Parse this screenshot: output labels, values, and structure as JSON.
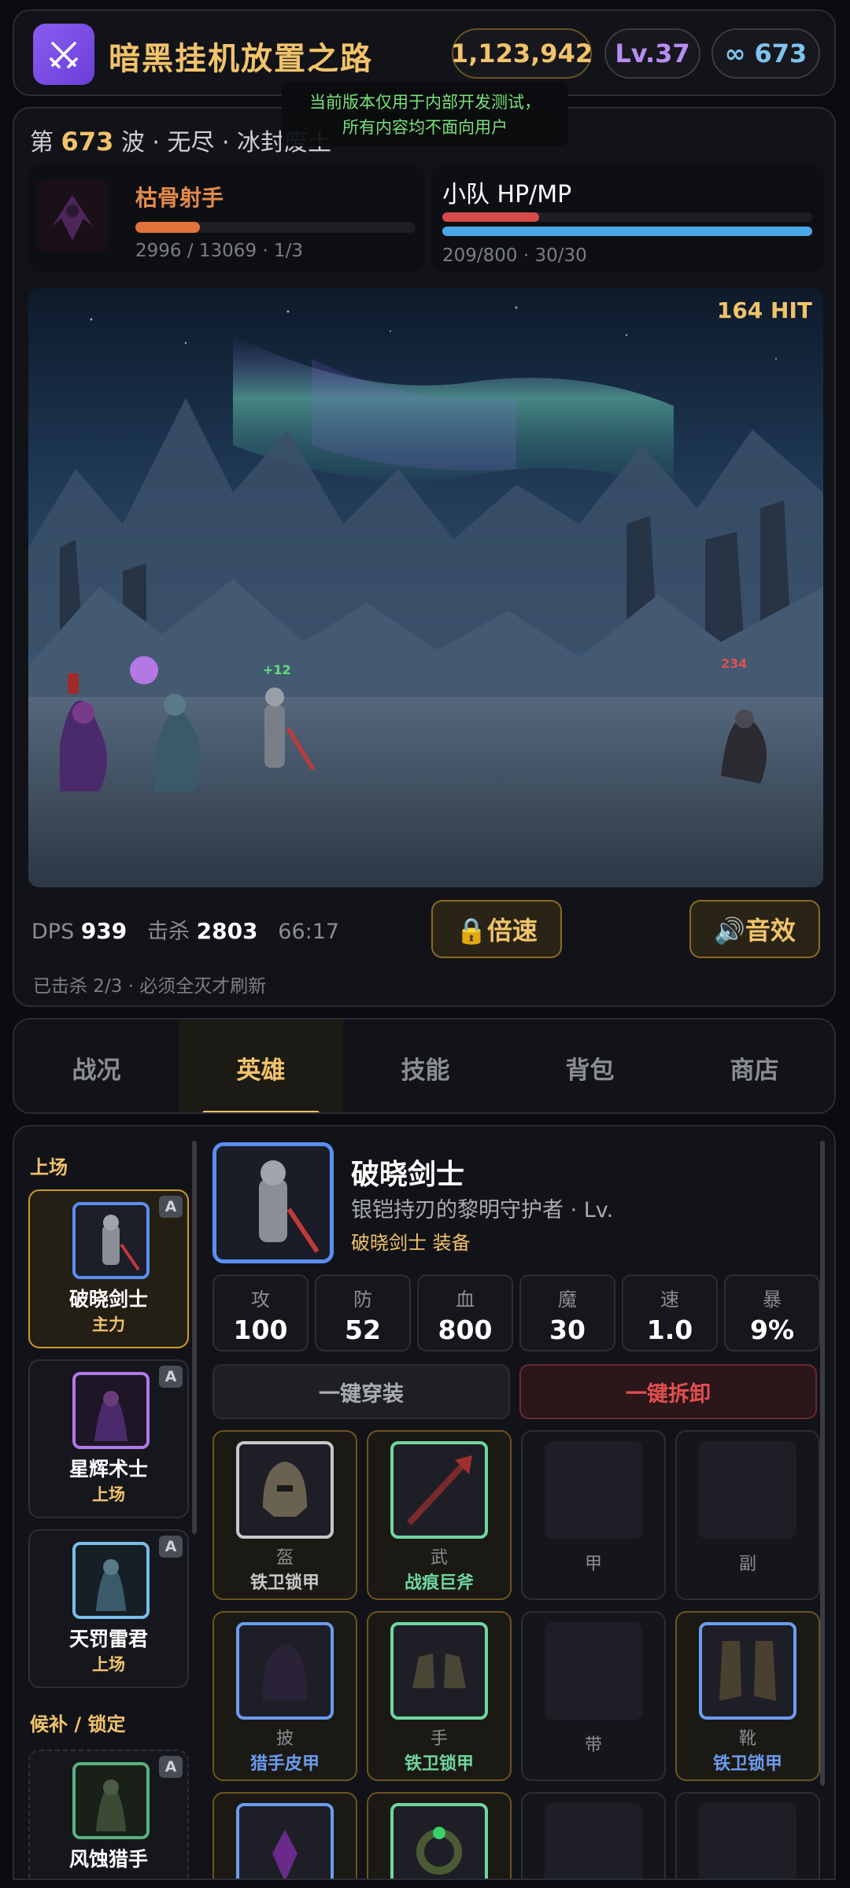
{
  "app": {
    "title": "暗黑挂机放置之路",
    "gold": "1,123,942",
    "level": "Lv.37",
    "infinite": "∞ 673"
  },
  "notice": {
    "line1": "当前版本仅用于内部开发测试，",
    "line2": "所有内容均不面向用户"
  },
  "wave": {
    "prefix": "第",
    "number": "673",
    "suffix": "波 · 无尽 · 冰封废土"
  },
  "enemy": {
    "name": "枯骨射手",
    "hp_text": "2996 / 13069 · 1/3",
    "hp_fraction": 0.229,
    "color": "#e0743a"
  },
  "party": {
    "title": "小队 HP/MP",
    "hp_fraction": 0.2613,
    "mp_fraction": 1.0,
    "text": "209/800 · 30/30",
    "hp_color": "#d64a4a",
    "mp_color": "#4aa8e8"
  },
  "scene": {
    "hit": "164 HIT",
    "heal_popup": "+12",
    "damage_popup": "234"
  },
  "stats": {
    "dps_label": "DPS",
    "dps": "939",
    "kills_label": "击杀",
    "kills": "2803",
    "time": "66:17",
    "speed_button": "🔒倍速",
    "sound_button": "🔊音效",
    "kill_info": "已击杀 2/3 · 必须全灭才刷新"
  },
  "tabs": [
    {
      "label": "战况"
    },
    {
      "label": "英雄"
    },
    {
      "label": "技能"
    },
    {
      "label": "背包"
    },
    {
      "label": "商店"
    }
  ],
  "roster": {
    "section_active": "上场",
    "section_bench": "候补 / 锁定",
    "badge": "A",
    "heroes": [
      {
        "name": "破晓剑士",
        "role": "主力"
      },
      {
        "name": "星辉术士",
        "role": "上场"
      },
      {
        "name": "天罚雷君",
        "role": "上场"
      },
      {
        "name": "风蚀猎手",
        "role": ""
      }
    ]
  },
  "hero_detail": {
    "name": "破晓剑士",
    "desc": "银铠持刃的黎明守护者 · Lv.",
    "equip_label": "破晓剑士 装备",
    "stats": [
      {
        "label": "攻",
        "value": "100"
      },
      {
        "label": "防",
        "value": "52"
      },
      {
        "label": "血",
        "value": "800"
      },
      {
        "label": "魔",
        "value": "30"
      },
      {
        "label": "速",
        "value": "1.0"
      },
      {
        "label": "暴",
        "value": "9%"
      }
    ],
    "equip_all": "一键穿装",
    "unequip_all": "一键拆卸",
    "slots": [
      {
        "slot": "盔",
        "item": "铁卫锁甲",
        "rarity_color": "#c8c8cc",
        "item_color": "#c8c8cc"
      },
      {
        "slot": "武",
        "item": "战痕巨斧",
        "rarity_color": "#6fd6a0",
        "item_color": "#6fd6a0"
      },
      {
        "slot": "甲",
        "item": ""
      },
      {
        "slot": "副",
        "item": ""
      },
      {
        "slot": "披",
        "item": "猎手皮甲",
        "rarity_color": "#6b9cf0",
        "item_color": "#6b9cf0"
      },
      {
        "slot": "手",
        "item": "铁卫锁甲",
        "rarity_color": "#6fd6a0",
        "item_color": "#6fd6a0"
      },
      {
        "slot": "带",
        "item": ""
      },
      {
        "slot": "靴",
        "item": "铁卫锁甲",
        "rarity_color": "#6b9cf0",
        "item_color": "#6b9cf0"
      }
    ]
  }
}
